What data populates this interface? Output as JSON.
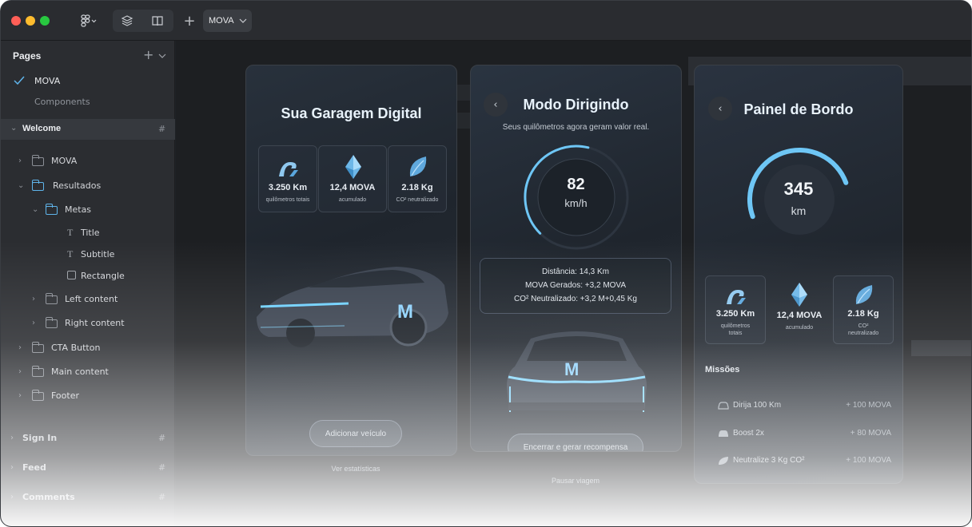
{
  "toolbar": {
    "file_tab": "MOVA",
    "add_icon": "plus-icon",
    "colors": {
      "close": "#ff5f57",
      "minimize": "#febc2e",
      "zoom": "#28c840"
    }
  },
  "sidebar": {
    "pages_label": "Pages",
    "pages": [
      {
        "label": "MOVA"
      },
      {
        "label": "Components"
      }
    ],
    "layers_header": "Welcome",
    "layers": [
      {
        "label": "MOVA"
      },
      {
        "label": "Resultados"
      },
      {
        "label": "Metas"
      },
      {
        "label": "Title"
      },
      {
        "label": "Subtitle"
      },
      {
        "label": "Rectangle"
      },
      {
        "label": "Left content"
      },
      {
        "label": "Right content"
      },
      {
        "label": "CTA Button"
      },
      {
        "label": "Main content"
      },
      {
        "label": "Footer"
      }
    ],
    "sections": [
      {
        "label": "Sign In"
      },
      {
        "label": "Feed"
      },
      {
        "label": "Comments"
      }
    ]
  },
  "garagem": {
    "title": "Sua Garagem Digital",
    "stats": [
      {
        "value": "3.250 Km",
        "label": "quilômetros totais"
      },
      {
        "value": "12,4 MOVA",
        "label": "acumulado"
      },
      {
        "value": "2.18 Kg",
        "label": "CO² neutralizado"
      }
    ],
    "car_logo": "M",
    "button": "Adicionar veículo",
    "link": "Ver estatísticas"
  },
  "dirigindo": {
    "title": "Modo Dirigindo",
    "subtitle": "Seus quilômetros agora geram valor real.",
    "speed": "82",
    "unit": "km/h",
    "gauge_fraction": 0.55,
    "info": [
      "Distância: 14,3 Km",
      "MOVA Gerados: +3,2 MOVA",
      "CO² Neutralizado: +3,2 M+0,45 Kg"
    ],
    "car_logo": "M",
    "button": "Encerrar e gerar recompensa",
    "link": "Pausar viagem"
  },
  "painel": {
    "title": "Painel de Bordo",
    "value": "345",
    "unit": "km",
    "gauge_fraction": 0.6,
    "stats": [
      {
        "value": "3.250 Km",
        "label": "quilômetros totais"
      },
      {
        "value": "12,4 MOVA",
        "label": "acumulado"
      },
      {
        "value": "2.18 Kg",
        "label": "CO² neutralizado"
      }
    ],
    "missions_title": "Missões",
    "missions": [
      {
        "label": "Dirija 100 Km",
        "reward": "+ 100 MOVA",
        "icon": "car-icon"
      },
      {
        "label": "Boost 2x",
        "reward": "+ 80 MOVA",
        "icon": "boost-icon"
      },
      {
        "label": "Neutralize 3 Kg CO²",
        "reward": "+ 100 MOVA",
        "icon": "leaf-icon"
      }
    ]
  }
}
